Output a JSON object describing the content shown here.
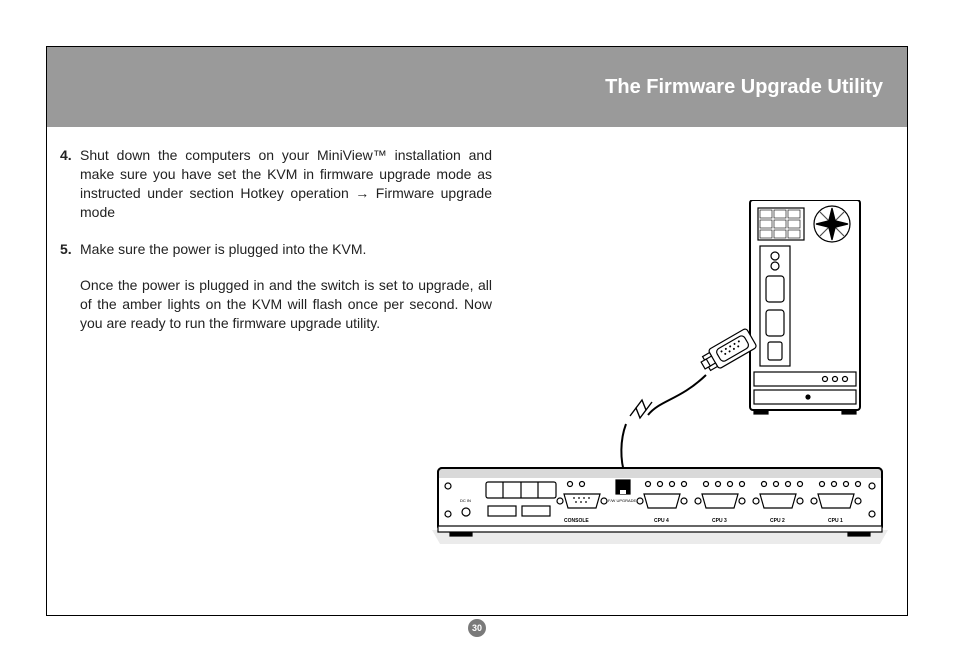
{
  "header": {
    "title": "The Firmware Upgrade Utility"
  },
  "steps": {
    "s4": {
      "num": "4.",
      "text": "Shut down the computers on your MiniView™ installation and make sure you have set the KVM in firmware upgrade mode as instructed under section Hotkey operation → Firmware upgrade mode"
    },
    "s5": {
      "num": "5.",
      "text": "Make sure the power is plugged into the KVM."
    }
  },
  "paragraph": "Once the power is plugged in and the switch is set to upgrade, all of the amber lights on the KVM will flash once per second. Now you are ready to run the firmware upgrade utility.",
  "figure_labels": {
    "console": "CONSOLE",
    "fw": "F/W UPGRADE",
    "cpu1": "CPU 1",
    "cpu2": "CPU 2",
    "cpu3": "CPU 3",
    "cpu4": "CPU 4"
  },
  "page_number": "30"
}
